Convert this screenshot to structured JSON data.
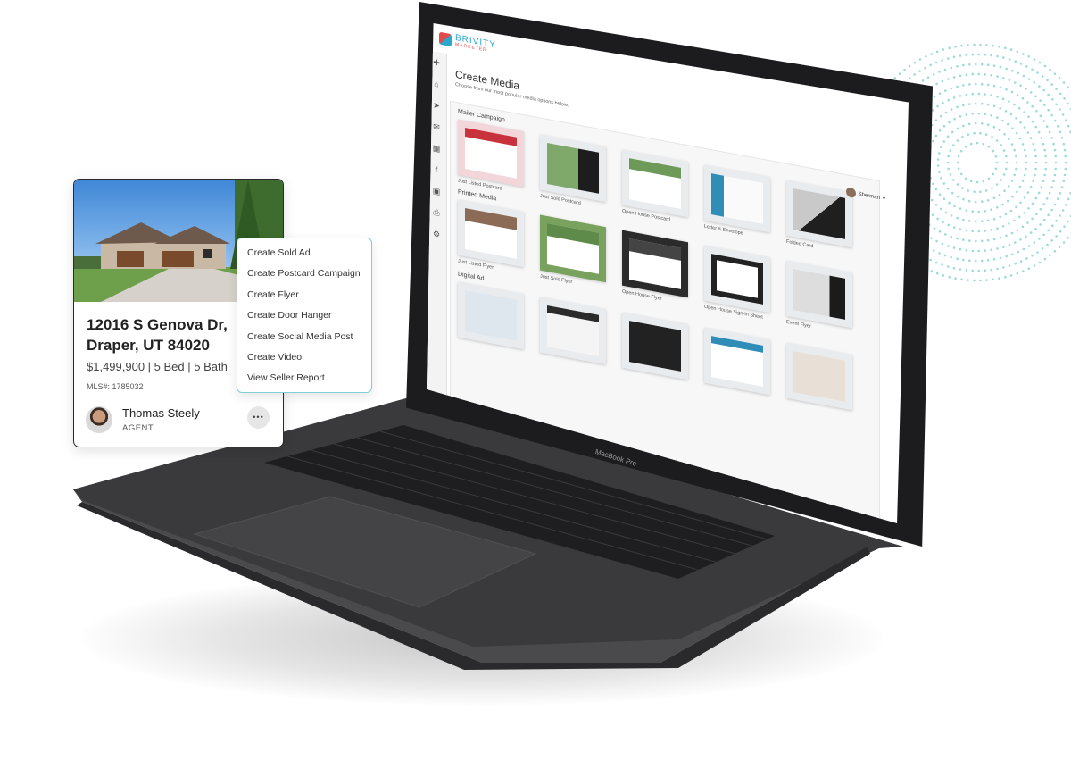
{
  "app": {
    "logo_text": "BRIVITY",
    "logo_sub": "MARKETER",
    "page_title": "Create Media",
    "page_subtitle": "Choose from our most popular media options below.",
    "user_name": "Sherman",
    "device_label": "MacBook Pro"
  },
  "sidebar": {
    "icons": [
      "plus-icon",
      "home-icon",
      "send-icon",
      "mail-icon",
      "grid-icon",
      "facebook-icon",
      "briefcase-icon",
      "print-icon",
      "gear-icon"
    ]
  },
  "sections": [
    {
      "title": "Mailer Campaign",
      "items": [
        "Just Listed Postcard",
        "Just Sold Postcard",
        "Open House Postcard",
        "Letter & Envelope",
        "Folded Card"
      ]
    },
    {
      "title": "Printed Media",
      "items": [
        "Just Listed Flyer",
        "Just Sold Flyer",
        "Open House Flyer",
        "Open House Sign-In Sheet",
        "Event Flyer"
      ]
    },
    {
      "title": "Digital Ad",
      "items": []
    }
  ],
  "property": {
    "address_line1": "12016 S Genova Dr,",
    "address_line2": "Draper, UT 84020",
    "facts": "$1,499,900 | 5 Bed | 5 Bath",
    "mls": "MLS#: 1785032",
    "agent_name": "Thomas Steely",
    "agent_role": "AGENT",
    "more_label": "•••"
  },
  "menu": {
    "items": [
      "Create Sold Ad",
      "Create Postcard Campaign",
      "Create Flyer",
      "Create Door Hanger",
      "Create Social Media Post",
      "Create Video",
      "View Seller Report"
    ]
  },
  "colors": {
    "accent": "#2aa7c9",
    "menu_border": "#7fd0d2",
    "laptop": "#3a3a3c",
    "bezel": "#1c1c1e"
  }
}
